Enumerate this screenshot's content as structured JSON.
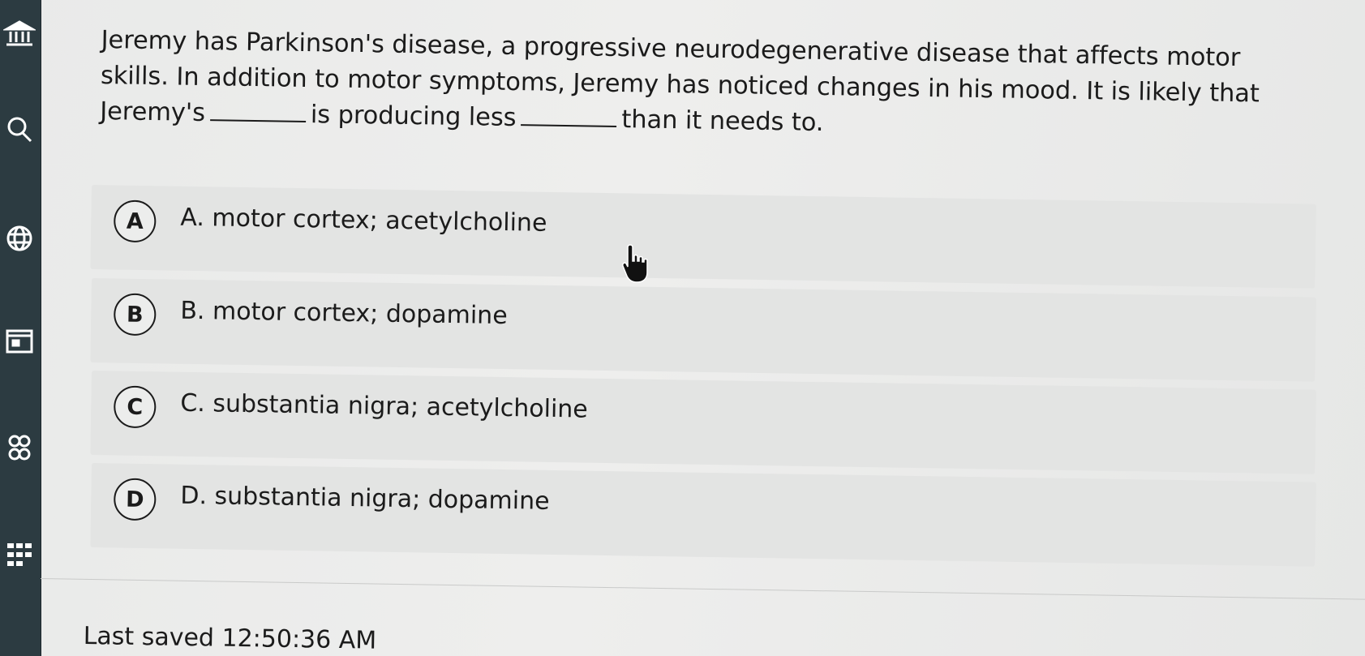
{
  "sidebar": {
    "icons": [
      "bank-icon",
      "search-icon",
      "globe-icon",
      "calendar-icon",
      "group-icon",
      "grid-icon"
    ]
  },
  "question": {
    "part1": "Jeremy has Parkinson's disease, a progressive neurodegenerative disease that affects motor skills. In addition to motor symptoms, Jeremy has noticed changes in his mood. It is likely that Jeremy's",
    "part2": "is producing less",
    "part3": "than it needs to."
  },
  "options": [
    {
      "letter": "A",
      "text": "A. motor cortex; acetylcholine"
    },
    {
      "letter": "B",
      "text": "B. motor cortex; dopamine"
    },
    {
      "letter": "C",
      "text": "C. substantia nigra; acetylcholine"
    },
    {
      "letter": "D",
      "text": "D. substantia nigra; dopamine"
    }
  ],
  "footer": {
    "last_saved": "Last saved 12:50:36 AM"
  }
}
